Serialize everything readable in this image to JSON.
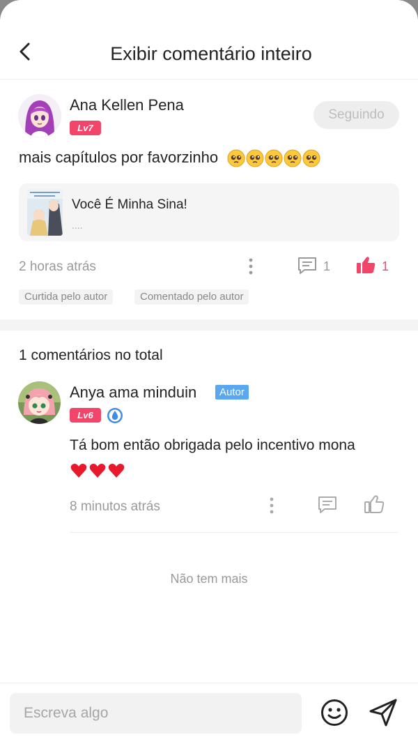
{
  "header": {
    "title": "Exibir comentário inteiro"
  },
  "comment": {
    "author": "Ana Kellen Pena",
    "level": "Lv7",
    "follow_label": "Seguindo",
    "text": "mais capítulos por favorzinho",
    "emoji_count": 5,
    "book": {
      "title": "Você É Minha Sina!",
      "subtitle": "...."
    },
    "time": "2 horas atrás",
    "reply_count": "1",
    "like_count": "1",
    "tags": [
      "Curtida pelo autor",
      "Comentado pelo autor"
    ]
  },
  "replies": {
    "total_label": "1 comentários no total",
    "items": [
      {
        "author": "Anya ama minduin",
        "author_badge": "Autor",
        "level": "Lv6",
        "text": "Tá bom então obrigada pelo incentivo mona",
        "hearts": 3,
        "time": "8 minutos atrás"
      }
    ]
  },
  "footer_note": "Não tem mais",
  "composer": {
    "placeholder": "Escreva algo"
  },
  "colors": {
    "accent": "#f2456a",
    "badge_blue": "#5aa7f0",
    "muted": "#999999"
  }
}
